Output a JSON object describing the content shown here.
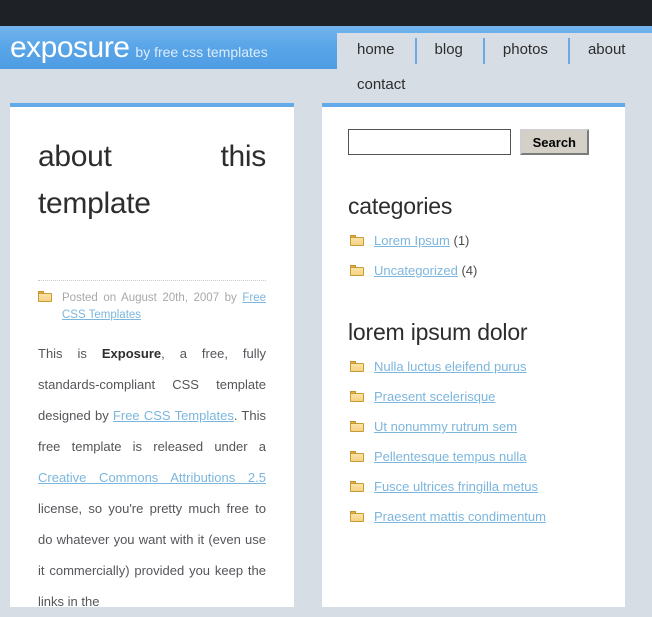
{
  "site": {
    "logo_main": "exposure",
    "logo_sub": "by free css templates"
  },
  "nav": {
    "items": [
      {
        "label": "home"
      },
      {
        "label": "blog"
      },
      {
        "label": "photos"
      },
      {
        "label": "about"
      },
      {
        "label": "contact"
      }
    ]
  },
  "post": {
    "title": "about this template",
    "meta_icon": "folder-icon",
    "meta_prefix": "Posted on August 20th, 2007 by ",
    "meta_author": "Free CSS Templates",
    "body": {
      "p1_a": "This is ",
      "p1_strong": "Exposure",
      "p1_b": ", a free, fully standards-compliant CSS template designed by ",
      "p1_link1": "Free CSS Templates",
      "p1_c": ". This free template is released under a ",
      "p1_link2": "Creative Commons Attributions 2.5",
      "p1_d": " license, so you're pretty much free to do whatever you want with it (even use it commercially) provided you keep the links in the"
    }
  },
  "sidebar": {
    "search": {
      "value": "",
      "placeholder": "",
      "button_label": "Search"
    },
    "categories": {
      "title": "categories",
      "items": [
        {
          "icon": "folder-icon",
          "label": "Lorem Ipsum",
          "count": "(1)"
        },
        {
          "icon": "folder-icon",
          "label": "Uncategorized",
          "count": "(4)"
        }
      ]
    },
    "lorem": {
      "title": "lorem ipsum dolor",
      "items": [
        {
          "icon": "folder-icon",
          "label": "Nulla luctus eleifend purus"
        },
        {
          "icon": "folder-icon",
          "label": "Praesent scelerisque"
        },
        {
          "icon": "folder-icon",
          "label": "Ut nonummy rutrum sem"
        },
        {
          "icon": "folder-icon",
          "label": "Pellentesque tempus nulla"
        },
        {
          "icon": "folder-icon",
          "label": "Fusce ultrices fringilla metus"
        },
        {
          "icon": "folder-icon",
          "label": "Praesent mattis condimentum"
        }
      ]
    }
  },
  "colors": {
    "page_background": "#d6dde5",
    "topbar": "#1e2227",
    "header_blue": "#5aa6e8",
    "accent_border": "#62abe8",
    "link": "#7cb6dd",
    "folder": "#f6d385"
  }
}
